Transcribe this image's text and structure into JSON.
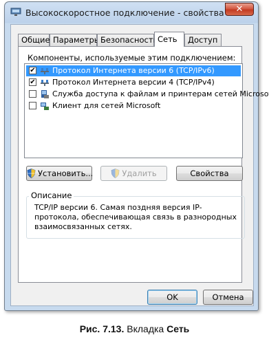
{
  "window": {
    "title": "Высокоскоростное подключение - свойства",
    "close_glyph": "✕"
  },
  "tabs": [
    {
      "label": "Общие",
      "active": false
    },
    {
      "label": "Параметры",
      "active": false
    },
    {
      "label": "Безопасность",
      "active": false
    },
    {
      "label": "Сеть",
      "active": true
    },
    {
      "label": "Доступ",
      "active": false
    }
  ],
  "components": {
    "label": "Компоненты, используемые этим подключением:",
    "items": [
      {
        "label": "Протокол Интернета версии 6 (TCP/IPv6)",
        "checked": true,
        "selected": true,
        "icon": "network-protocol-icon"
      },
      {
        "label": "Протокол Интернета версии 4 (TCP/IPv4)",
        "checked": true,
        "selected": false,
        "icon": "network-protocol-icon"
      },
      {
        "label": "Служба доступа к файлам и принтерам сетей Microsoft",
        "checked": false,
        "selected": false,
        "icon": "file-printer-sharing-icon"
      },
      {
        "label": "Клиент для сетей Microsoft",
        "checked": false,
        "selected": false,
        "icon": "network-client-icon"
      }
    ]
  },
  "buttons": {
    "install": "Установить...",
    "remove": "Удалить",
    "properties": "Свойства",
    "ok": "OK",
    "cancel": "Отмена"
  },
  "description": {
    "label": "Описание",
    "text": "TCP/IP версии 6. Самая поздняя версия IP-протокола, обеспечивающая связь в разнородных взаимосвязанных сетях."
  },
  "caption": {
    "prefix": "Рис. 7.13.",
    "middle": "Вкладка",
    "bold": "Сеть"
  },
  "colors": {
    "selection": "#3399ff",
    "close_button": "#c23b22",
    "ok_focus_border": "#3c7fb1"
  }
}
